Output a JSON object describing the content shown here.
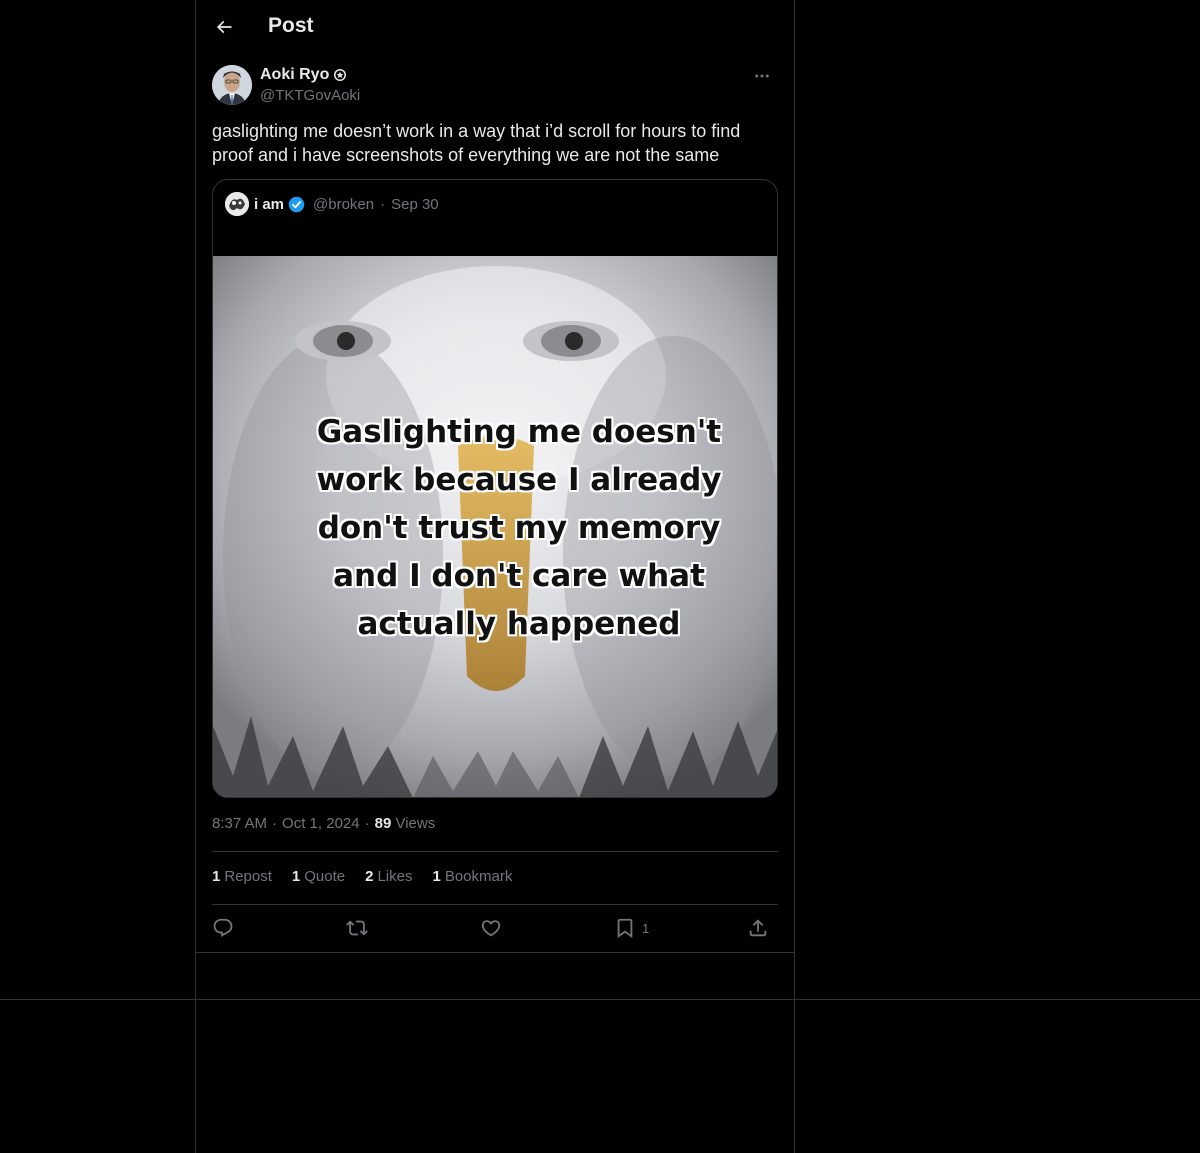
{
  "header": {
    "title": "Post"
  },
  "author": {
    "name": "Aoki Ryo",
    "handle": "@TKTGovAoki"
  },
  "post": {
    "text": "gaslighting me doesn’t work in a way that i’d scroll for hours to find proof and i have screenshots of everything we are not the same"
  },
  "quote": {
    "name": "i am",
    "handle": "@broken",
    "dot": "·",
    "date": "Sep 30",
    "image_text": "Gaslighting me doesn't work because I already don't trust my memory and I don't care what actually happened"
  },
  "meta": {
    "time": "8:37 AM",
    "dot": "·",
    "date": "Oct 1, 2024",
    "dot2": "·",
    "views_count": "89",
    "views_label": "Views"
  },
  "stats": [
    {
      "count": "1",
      "label": "Repost"
    },
    {
      "count": "1",
      "label": "Quote"
    },
    {
      "count": "2",
      "label": "Likes"
    },
    {
      "count": "1",
      "label": "Bookmark"
    }
  ],
  "actions": {
    "reply_icon": "reply-icon",
    "repost_icon": "repost-icon",
    "like_icon": "heart-icon",
    "bookmark_icon": "bookmark-icon",
    "bookmark_count": "1",
    "share_icon": "share-icon"
  },
  "colors": {
    "background": "#000000",
    "border": "#2f3336",
    "text": "#e7e9ea",
    "muted": "#71767b",
    "verified": "#1d9bf0"
  }
}
